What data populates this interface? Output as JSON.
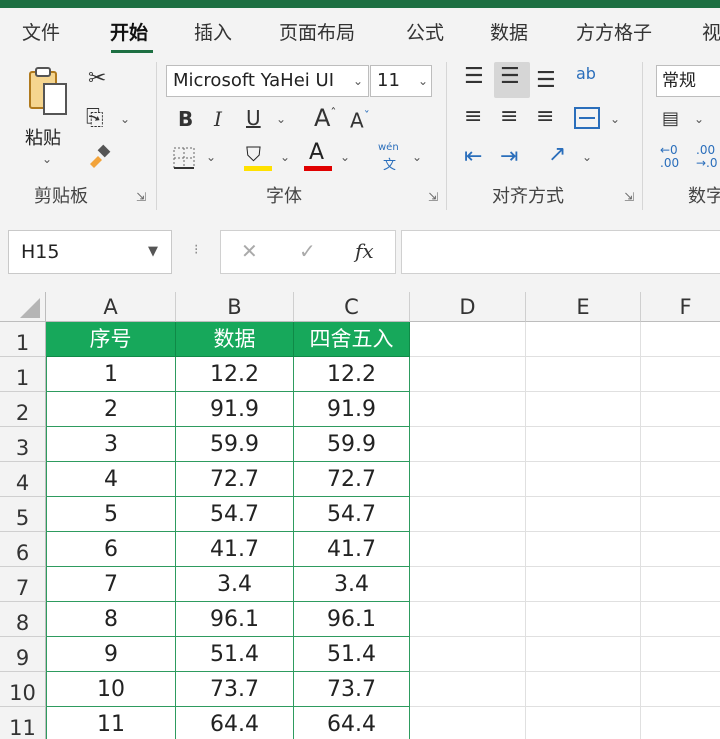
{
  "ribbon_tabs": [
    "文件",
    "开始",
    "插入",
    "页面布局",
    "公式",
    "数据",
    "方方格子",
    "视"
  ],
  "active_tab": "开始",
  "clipboard": {
    "paste_label": "粘贴",
    "group_label": "剪贴板"
  },
  "font": {
    "name": "Microsoft YaHei UI",
    "size": "11",
    "group_label": "字体",
    "bold": "B",
    "italic": "I",
    "underline": "U",
    "phonetic_top": "wén",
    "phonetic_bottom": "文",
    "highlight_color": "#ffe100",
    "font_color": "#e00000"
  },
  "alignment": {
    "group_label": "对齐方式",
    "wrap_text_glyph": "ab"
  },
  "number": {
    "format": "常规",
    "group_label": "数字",
    "inc_decimal_top": "←0",
    "inc_decimal_bottom": ".00",
    "dec_decimal_top": ".00",
    "dec_decimal_bottom": "→.0"
  },
  "formula_bar": {
    "name_box": "H15",
    "cancel": "✕",
    "enter": "✓",
    "fx": "fx",
    "content": ""
  },
  "columns": [
    "A",
    "B",
    "C",
    "D",
    "E",
    "F"
  ],
  "header_row": [
    "序号",
    "数据",
    "四舍五入"
  ],
  "rows": [
    {
      "n": "1",
      "a": "1",
      "b": "12.2",
      "c": "12.2"
    },
    {
      "n": "2",
      "a": "2",
      "b": "91.9",
      "c": "91.9"
    },
    {
      "n": "3",
      "a": "3",
      "b": "59.9",
      "c": "59.9"
    },
    {
      "n": "4",
      "a": "4",
      "b": "72.7",
      "c": "72.7"
    },
    {
      "n": "5",
      "a": "5",
      "b": "54.7",
      "c": "54.7"
    },
    {
      "n": "6",
      "a": "6",
      "b": "41.7",
      "c": "41.7"
    },
    {
      "n": "7",
      "a": "7",
      "b": "3.4",
      "c": "3.4"
    },
    {
      "n": "8",
      "a": "8",
      "b": "96.1",
      "c": "96.1"
    },
    {
      "n": "9",
      "a": "9",
      "b": "51.4",
      "c": "51.4"
    },
    {
      "n": "10",
      "a": "10",
      "b": "73.7",
      "c": "73.7"
    },
    {
      "n": "11",
      "a": "11",
      "b": "64.4",
      "c": "64.4"
    }
  ],
  "header_row_number": "1",
  "colors": {
    "accent": "#1d6f42",
    "header_fill": "#17a85b",
    "table_border": "#2e9b5f"
  }
}
